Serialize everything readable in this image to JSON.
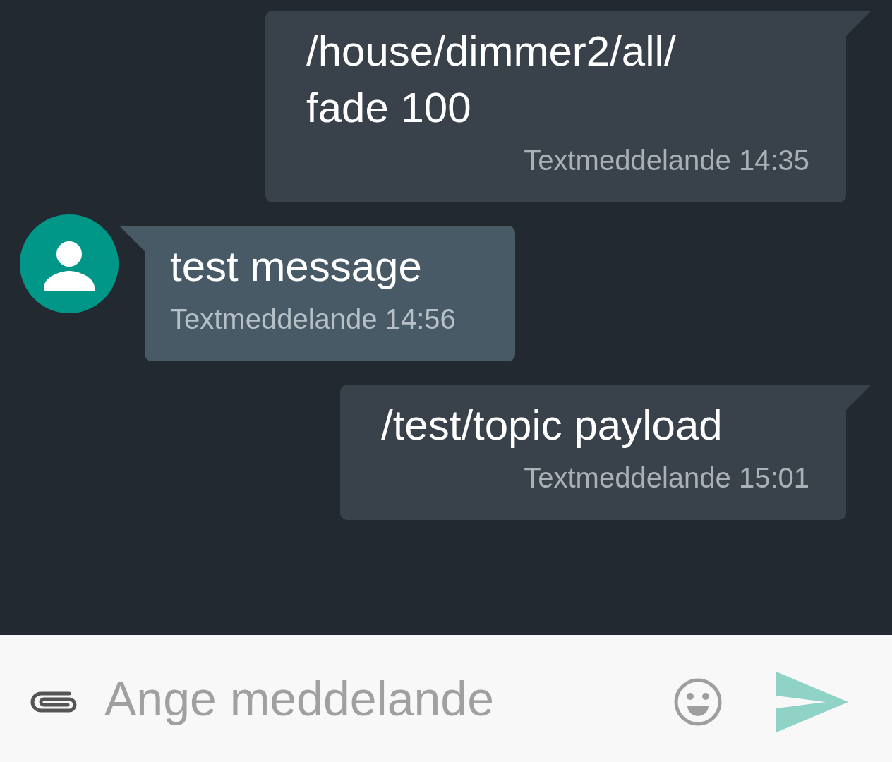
{
  "messages": [
    {
      "kind": "outgoing",
      "lines": [
        "/house/dimmer2/all/",
        "fade 100"
      ],
      "meta": "Textmeddelande 14:35"
    },
    {
      "kind": "incoming",
      "lines": [
        "test message"
      ],
      "meta": "Textmeddelande 14:56"
    },
    {
      "kind": "outgoing",
      "lines": [
        "/test/topic payload"
      ],
      "meta": "Textmeddelande 15:01"
    }
  ],
  "composer": {
    "placeholder": "Ange meddelande"
  }
}
